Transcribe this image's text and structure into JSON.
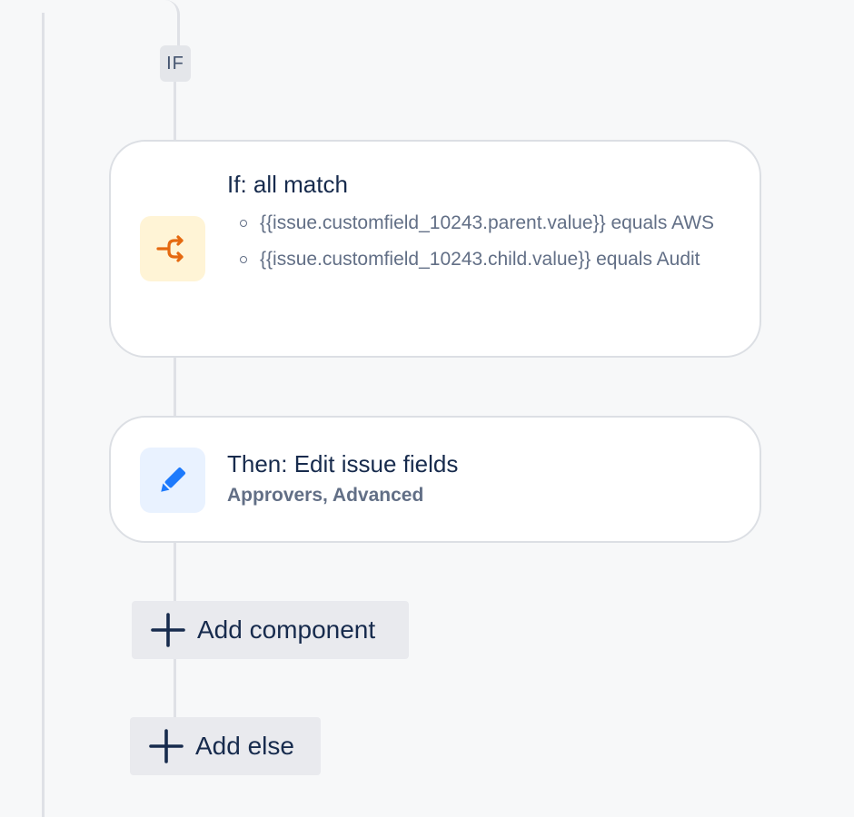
{
  "if_badge": "IF",
  "condition_card": {
    "title": "If: all match",
    "icon": "branch-icon",
    "conditions": [
      "{{issue.customfield_10243.parent.value}} equals AWS",
      "{{issue.customfield_10243.child.value}} equals Audit"
    ],
    "accent_color": "#e56910",
    "icon_bg": "#fff4d6"
  },
  "action_card": {
    "title": "Then: Edit issue fields",
    "subtitle": "Approvers, Advanced",
    "icon": "pencil-icon",
    "accent_color": "#1d7afc",
    "icon_bg": "#e9f2ff"
  },
  "buttons": {
    "add_component": "Add component",
    "add_else": "Add else"
  }
}
